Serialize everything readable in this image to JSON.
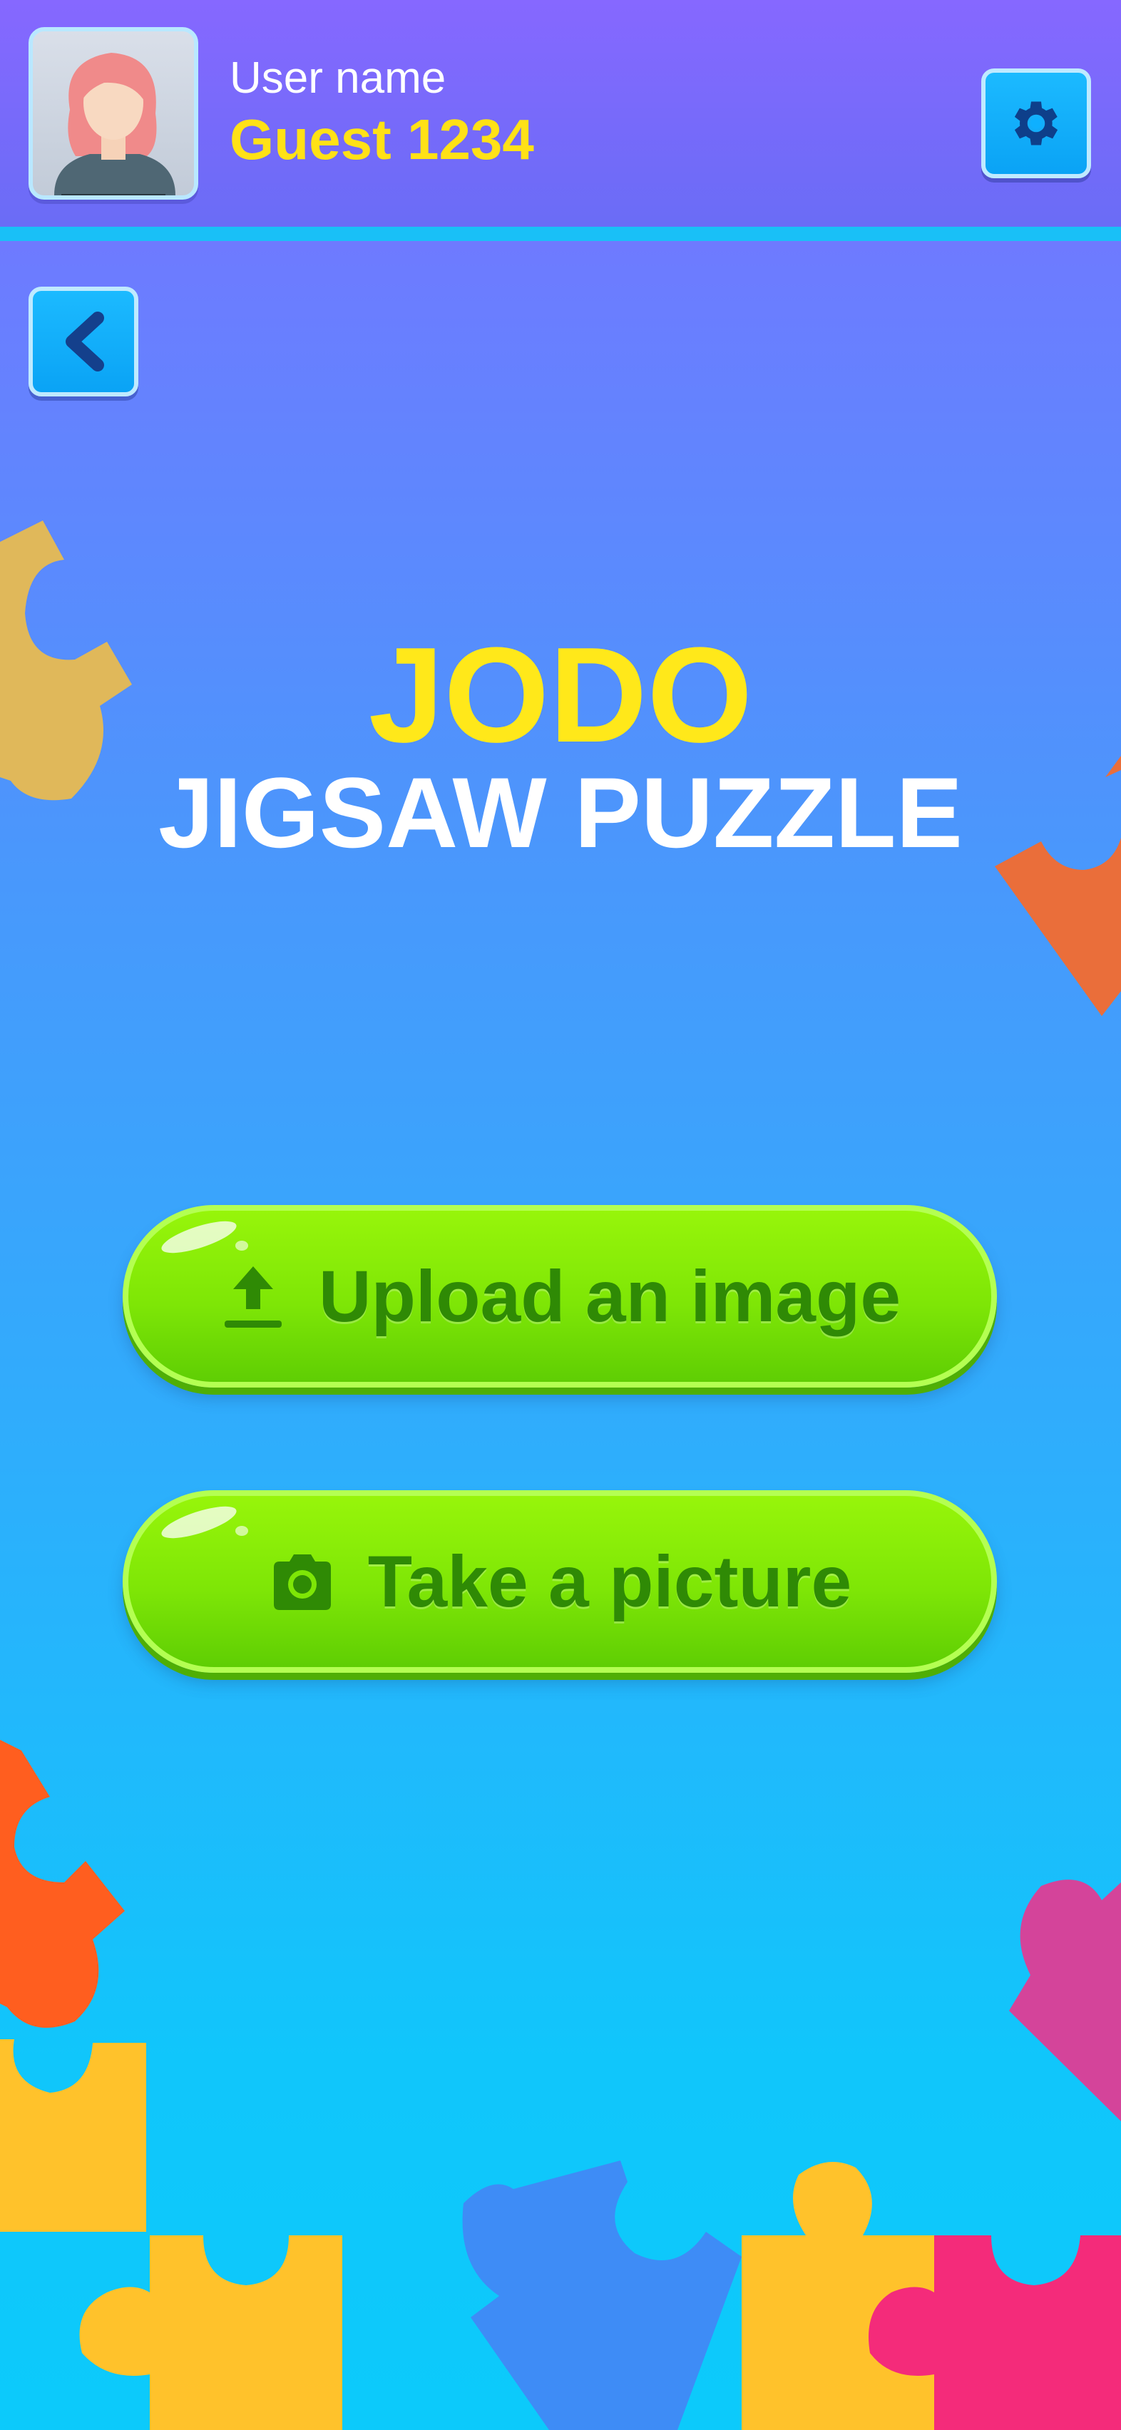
{
  "header": {
    "user_label": "User name",
    "user_name": "Guest 1234",
    "avatar_icon": "avatar-icon",
    "settings_icon": "gear-icon"
  },
  "nav": {
    "back_icon": "chevron-left-icon"
  },
  "title": {
    "main": "JODO",
    "sub": "JIGSAW PUZZLE"
  },
  "actions": {
    "upload_label": "Upload an image",
    "upload_icon": "upload-icon",
    "camera_label": "Take a picture",
    "camera_icon": "camera-icon"
  },
  "colors": {
    "title_yellow": "#ffe81a",
    "button_green": "#7ee606",
    "button_text": "#2f8a05",
    "accent_blue": "#19c0f7"
  }
}
